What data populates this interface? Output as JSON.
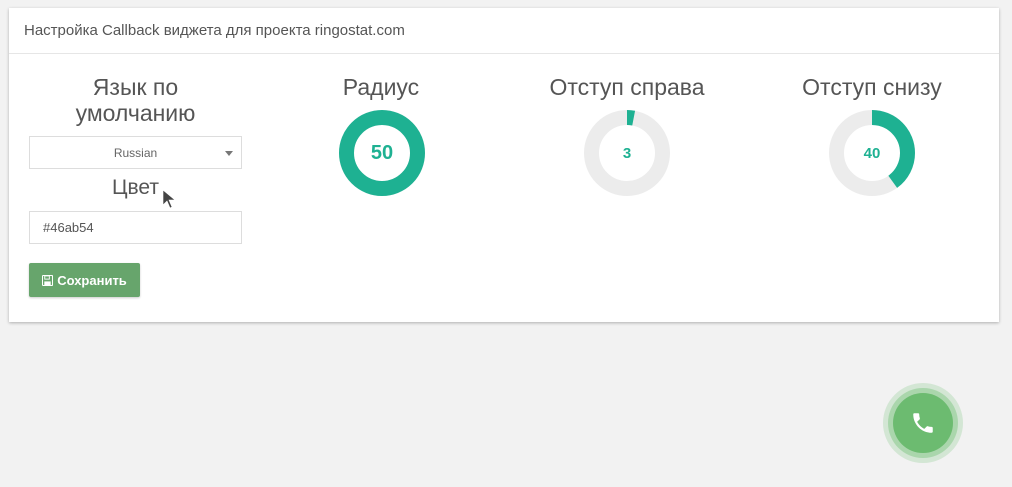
{
  "header": {
    "title": "Настройка Callback виджета для проекта ringostat.com"
  },
  "language": {
    "label": "Язык по умолчанию",
    "selected": "Russian"
  },
  "color": {
    "label": "Цвет",
    "value": "#46ab54"
  },
  "save": {
    "label": "Сохранить"
  },
  "gauges": [
    {
      "title": "Радиус",
      "value": "50",
      "fraction": 1.0
    },
    {
      "title": "Отступ справа",
      "value": "3",
      "fraction": 0.03
    },
    {
      "title": "Отступ снизу",
      "value": "40",
      "fraction": 0.4
    }
  ],
  "colors": {
    "accent": "#1eb192",
    "track": "#ececec",
    "save_button": "#67a56c",
    "callback_button": "#6cbb70"
  },
  "icons": {
    "save": "floppy-disk-icon",
    "phone": "phone-icon"
  }
}
